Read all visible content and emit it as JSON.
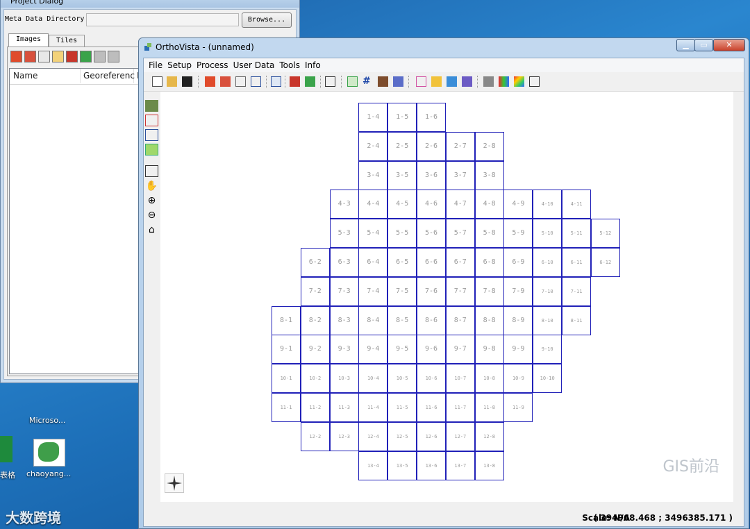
{
  "project_dialog": {
    "title": "Project Dialog",
    "meta_label": "Meta Data Directory",
    "browse_label": "Browse...",
    "tabs": [
      "Images",
      "Tiles"
    ],
    "columns": [
      "Name",
      "Georeferenc",
      "Im"
    ]
  },
  "desktop": {
    "labels": {
      "microsoft": "Microso...",
      "table": "表格",
      "chaoyang": "chaoyang...",
      "brand": "大数跨境"
    }
  },
  "main_window": {
    "title": "OrthoVista - (unnamed)",
    "menu": [
      "File",
      "Setup",
      "Process",
      "User Data",
      "Tools",
      "Info"
    ],
    "status": {
      "scale": "Scale: N/A",
      "coords": "( 394968.468 ; 3496385.171 )"
    },
    "watermark": "GIS前沿"
  },
  "tiles": {
    "rows": [
      {
        "row": 1,
        "cols": [
          4,
          5,
          6
        ]
      },
      {
        "row": 2,
        "cols": [
          4,
          5,
          6,
          7,
          8
        ]
      },
      {
        "row": 3,
        "cols": [
          4,
          5,
          6,
          7,
          8
        ]
      },
      {
        "row": 4,
        "cols": [
          3,
          4,
          5,
          6,
          7,
          8,
          9,
          10,
          11
        ]
      },
      {
        "row": 5,
        "cols": [
          3,
          4,
          5,
          6,
          7,
          8,
          9,
          10,
          11,
          12
        ]
      },
      {
        "row": 6,
        "cols": [
          2,
          3,
          4,
          5,
          6,
          7,
          8,
          9,
          10,
          11,
          12
        ]
      },
      {
        "row": 7,
        "cols": [
          2,
          3,
          4,
          5,
          6,
          7,
          8,
          9,
          10,
          11
        ]
      },
      {
        "row": 8,
        "cols": [
          1,
          2,
          3,
          4,
          5,
          6,
          7,
          8,
          9,
          10,
          11
        ]
      },
      {
        "row": 9,
        "cols": [
          1,
          2,
          3,
          4,
          5,
          6,
          7,
          8,
          9,
          10
        ]
      },
      {
        "row": 10,
        "cols": [
          1,
          2,
          3,
          4,
          5,
          6,
          7,
          8,
          9,
          10
        ]
      },
      {
        "row": 11,
        "cols": [
          1,
          2,
          3,
          4,
          5,
          6,
          7,
          8,
          9
        ]
      },
      {
        "row": 12,
        "cols": [
          2,
          3,
          4,
          5,
          6,
          7,
          8
        ]
      },
      {
        "row": 13,
        "cols": [
          4,
          5,
          6,
          7,
          8
        ]
      }
    ]
  }
}
